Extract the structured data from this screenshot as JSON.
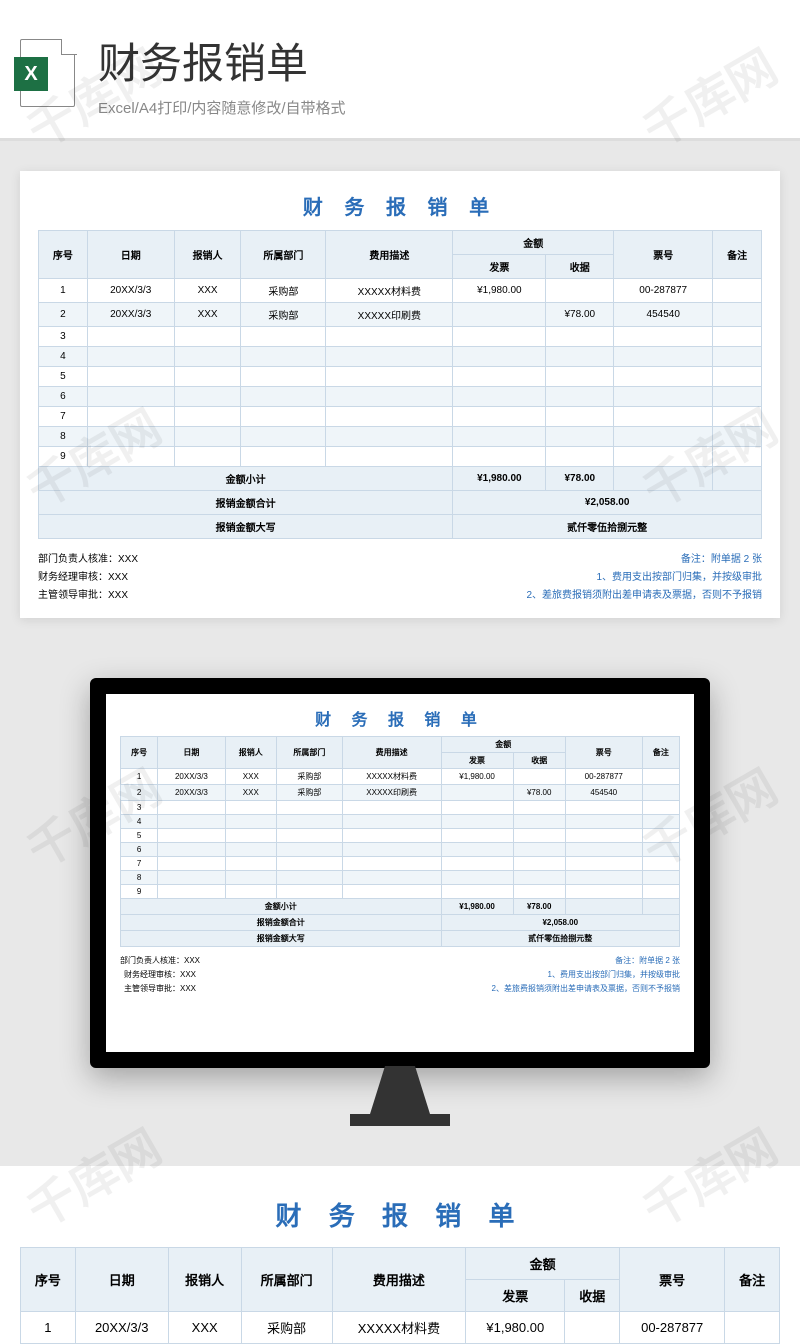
{
  "header": {
    "title": "财务报销单",
    "subtitle": "Excel/A4打印/内容随意修改/自带格式",
    "icon_letter": "X"
  },
  "watermark": "千库网",
  "form": {
    "title": "财 务 报 销 单",
    "cols": {
      "seq": "序号",
      "date": "日期",
      "person": "报销人",
      "dept": "所属部门",
      "desc": "费用描述",
      "amount": "金额",
      "invoice": "发票",
      "receipt": "收据",
      "ticket": "票号",
      "note": "备注"
    },
    "rows": [
      {
        "seq": "1",
        "date": "20XX/3/3",
        "person": "XXX",
        "dept": "采购部",
        "desc": "XXXXX材料费",
        "invoice": "¥1,980.00",
        "receipt": "",
        "ticket": "00-287877",
        "note": ""
      },
      {
        "seq": "2",
        "date": "20XX/3/3",
        "person": "XXX",
        "dept": "采购部",
        "desc": "XXXXX印刷费",
        "invoice": "",
        "receipt": "¥78.00",
        "ticket": "454540",
        "note": ""
      },
      {
        "seq": "3"
      },
      {
        "seq": "4"
      },
      {
        "seq": "5"
      },
      {
        "seq": "6"
      },
      {
        "seq": "7"
      },
      {
        "seq": "8"
      },
      {
        "seq": "9"
      }
    ],
    "subtotal_label": "金额小计",
    "subtotal_invoice": "¥1,980.00",
    "subtotal_receipt": "¥78.00",
    "total_label": "报销金额合计",
    "total_value": "¥2,058.00",
    "caps_label": "报销金额大写",
    "caps_value": "贰仟零伍拾捌元整",
    "ap1": "部门负责人核准：XXX",
    "ap2": "财务经理审核：XXX",
    "ap3": "主管领导审批：XXX",
    "rem_title": "备注：附单据 2 张",
    "rem1": "1、费用支出按部门归集，并按级审批",
    "rem2": "2、差旅费报销须附出差申请表及票据，否则不予报销"
  }
}
